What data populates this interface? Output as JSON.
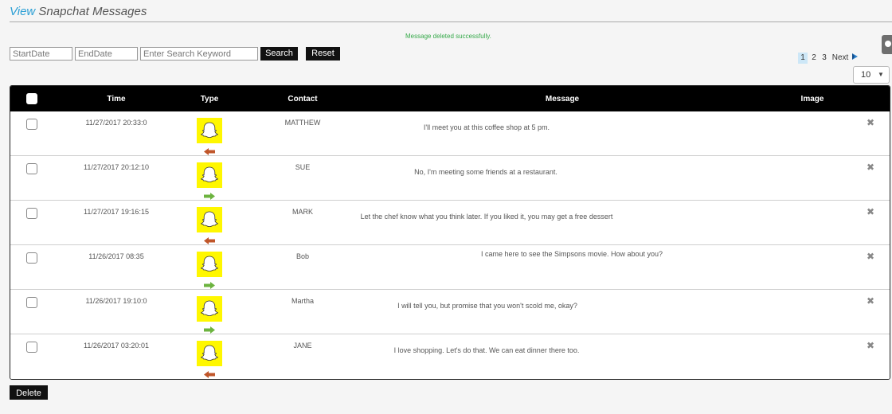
{
  "header": {
    "title_prefix": "View",
    "title_rest": " Snapchat Messages"
  },
  "status_message": "Message deleted successfully.",
  "filters": {
    "start_placeholder": "StartDate",
    "end_placeholder": "EndDate",
    "keyword_placeholder": "Enter Search Keyword",
    "search_label": "Search",
    "reset_label": "Reset"
  },
  "pagination": {
    "pages": [
      "1",
      "2",
      "3"
    ],
    "current": "1",
    "next_label": "Next"
  },
  "page_size": "10",
  "table": {
    "columns": [
      "Time",
      "Type",
      "Contact",
      "Message",
      "Image"
    ],
    "rows": [
      {
        "time": "11/27/2017 20:33:0",
        "direction": "incoming",
        "contact": "MATTHEW",
        "message": "I'll meet you at this coffee shop at 5 pm."
      },
      {
        "time": "11/27/2017 20:12:10",
        "direction": "outgoing",
        "contact": "SUE",
        "message": "No, I'm meeting some friends at a restaurant."
      },
      {
        "time": "11/27/2017 19:16:15",
        "direction": "incoming",
        "contact": "MARK",
        "message": "Let the chef know what you think later. If you liked it, you may get a free dessert"
      },
      {
        "time": "11/26/2017 08:35",
        "direction": "outgoing",
        "contact": "Bob",
        "message": "I came here to see the Simpsons movie. How about you?"
      },
      {
        "time": "11/26/2017 19:10:0",
        "direction": "outgoing",
        "contact": "Martha",
        "message": "I will tell you, but promise that you won't scold me, okay?"
      },
      {
        "time": "11/26/2017 03:20:01",
        "direction": "incoming",
        "contact": "JANE",
        "message": "I love shopping. Let's do that. We can eat dinner there too."
      }
    ],
    "type_icon": "snapchat-ghost-icon",
    "delete_icon": "close-icon"
  },
  "footer": {
    "delete_label": "Delete"
  },
  "colors": {
    "title_accent": "#2b9fd5",
    "status_green": "#36a94a",
    "snap_yellow": "#fff700",
    "incoming_arrow": "#c0562a",
    "outgoing_arrow": "#6cb33f",
    "header_bg": "#000000"
  }
}
